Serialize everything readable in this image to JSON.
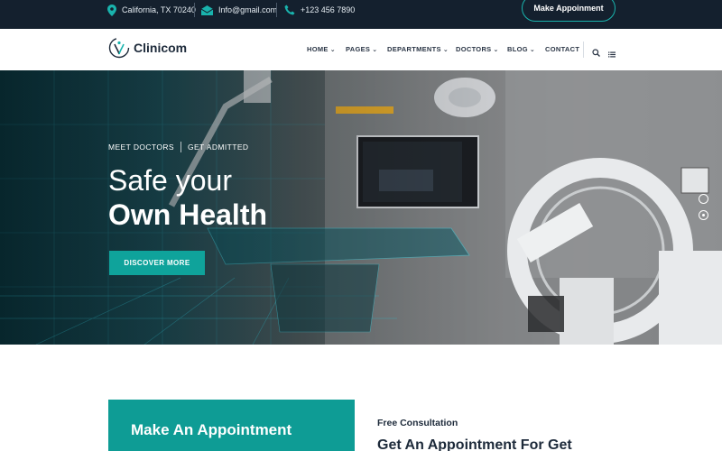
{
  "topbar": {
    "address": "California, TX 70240",
    "email": "Info@gmail.com",
    "phone": "+123 456 7890",
    "appointment_button": "Make Appoinment"
  },
  "brand": {
    "name": "Clinicom"
  },
  "nav": {
    "items": [
      {
        "label": "HOME"
      },
      {
        "label": "PAGES"
      },
      {
        "label": "DEPARTMENTS"
      },
      {
        "label": "DOCTORS"
      },
      {
        "label": "BLOG"
      },
      {
        "label": "CONTACT"
      }
    ]
  },
  "hero": {
    "tag1": "MEET DOCTORS",
    "tag2": "GET ADMITTED",
    "line1": "Safe your",
    "line2": "Own Health",
    "button": "DISCOVER MORE"
  },
  "appointment": {
    "card_title": "Make An Appointment",
    "eyebrow": "Free Consultation",
    "heading": "Get An Appointment For Get"
  },
  "colors": {
    "accent": "#0fa39b",
    "topbar": "#14202e",
    "accent_outline": "#19b3ad"
  },
  "icons": [
    "location-pin-icon",
    "mail-icon",
    "phone-icon",
    "search-icon",
    "menu-icon"
  ]
}
